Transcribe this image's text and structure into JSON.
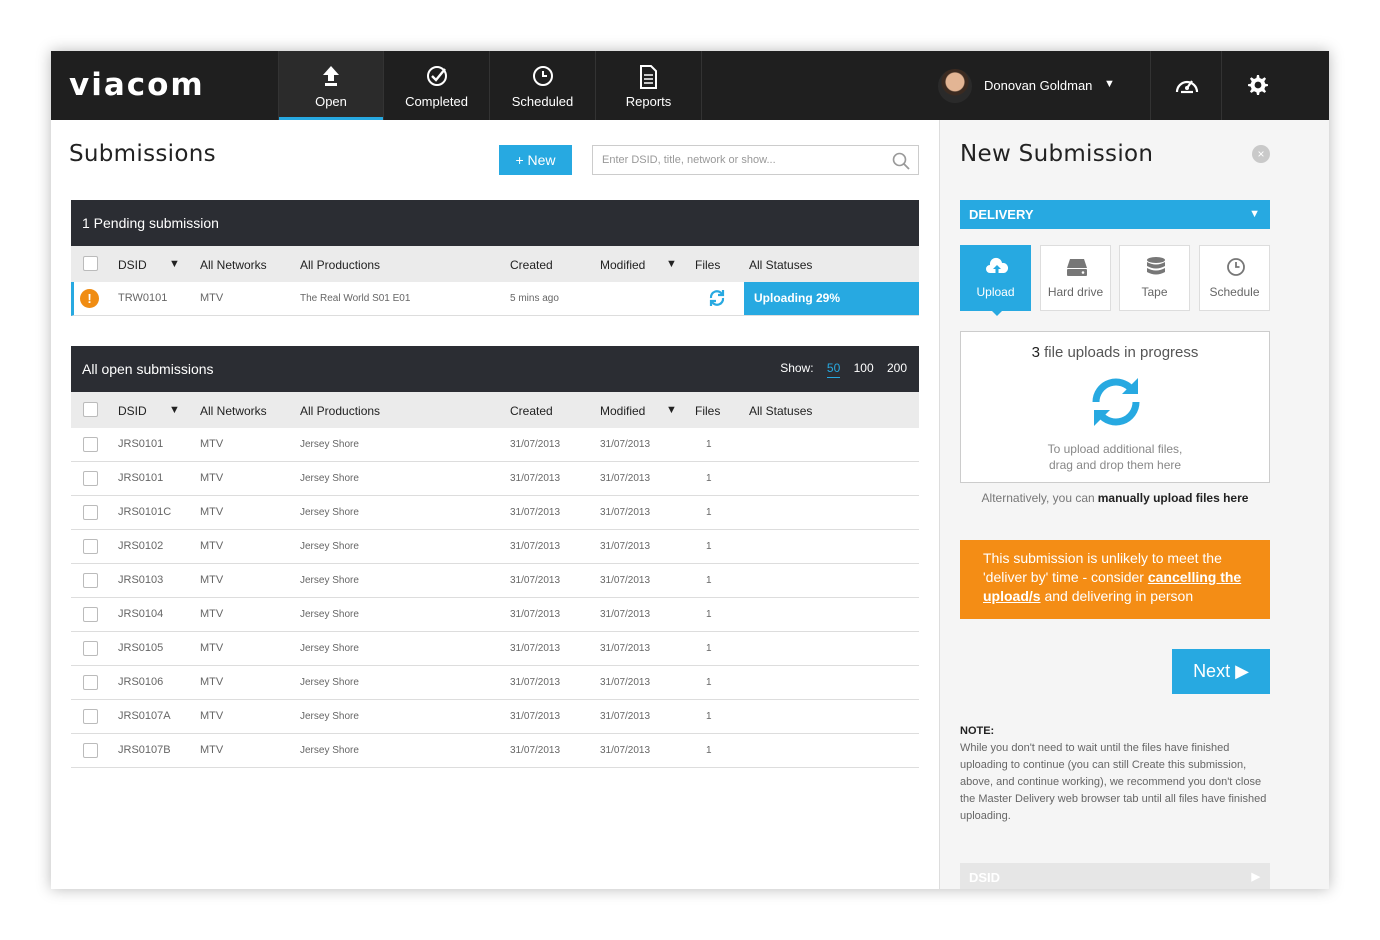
{
  "brand": {
    "logo": "viacom"
  },
  "nav": {
    "items": [
      {
        "label": "Open",
        "icon": "upload-arrow-icon",
        "active": true
      },
      {
        "label": "Completed",
        "icon": "check-circle-icon",
        "active": false
      },
      {
        "label": "Scheduled",
        "icon": "clock-icon",
        "active": false
      },
      {
        "label": "Reports",
        "icon": "document-icon",
        "active": false
      }
    ]
  },
  "user": {
    "name": "Donovan Goldman",
    "caret": "▼"
  },
  "toolbar_icons": [
    "speedometer-icon",
    "gear-icon"
  ],
  "submissions": {
    "title": "Submissions",
    "new_label": "+ New",
    "search_placeholder": "Enter DSID, title, network or show..."
  },
  "pending": {
    "header": "1 Pending submission",
    "columns": {
      "dsid": "DSID",
      "networks": "All Networks",
      "productions": "All Productions",
      "created": "Created",
      "modified": "Modified",
      "files": "Files",
      "statuses": "All Statuses"
    },
    "rows": [
      {
        "dsid": "TRW0101",
        "network": "MTV",
        "production": "The Real World S01 E01",
        "created": "5 mins ago",
        "modified": "",
        "status": "Uploading 29%",
        "warning": "!"
      }
    ]
  },
  "open": {
    "header": "All open submissions",
    "show_label": "Show:",
    "show_options": [
      "50",
      "100",
      "200"
    ],
    "show_selected": "50",
    "columns": {
      "dsid": "DSID",
      "networks": "All Networks",
      "productions": "All Productions",
      "created": "Created",
      "modified": "Modified",
      "files": "Files",
      "statuses": "All Statuses"
    },
    "rows": [
      {
        "dsid": "JRS0101",
        "network": "MTV",
        "production": "Jersey Shore",
        "created": "31/07/2013",
        "modified": "31/07/2013",
        "files": "1"
      },
      {
        "dsid": "JRS0101",
        "network": "MTV",
        "production": "Jersey Shore",
        "created": "31/07/2013",
        "modified": "31/07/2013",
        "files": "1"
      },
      {
        "dsid": "JRS0101C",
        "network": "MTV",
        "production": "Jersey Shore",
        "created": "31/07/2013",
        "modified": "31/07/2013",
        "files": "1"
      },
      {
        "dsid": "JRS0102",
        "network": "MTV",
        "production": "Jersey Shore",
        "created": "31/07/2013",
        "modified": "31/07/2013",
        "files": "1"
      },
      {
        "dsid": "JRS0103",
        "network": "MTV",
        "production": "Jersey Shore",
        "created": "31/07/2013",
        "modified": "31/07/2013",
        "files": "1"
      },
      {
        "dsid": "JRS0104",
        "network": "MTV",
        "production": "Jersey Shore",
        "created": "31/07/2013",
        "modified": "31/07/2013",
        "files": "1"
      },
      {
        "dsid": "JRS0105",
        "network": "MTV",
        "production": "Jersey Shore",
        "created": "31/07/2013",
        "modified": "31/07/2013",
        "files": "1"
      },
      {
        "dsid": "JRS0106",
        "network": "MTV",
        "production": "Jersey Shore",
        "created": "31/07/2013",
        "modified": "31/07/2013",
        "files": "1"
      },
      {
        "dsid": "JRS0107A",
        "network": "MTV",
        "production": "Jersey Shore",
        "created": "31/07/2013",
        "modified": "31/07/2013",
        "files": "1"
      },
      {
        "dsid": "JRS0107B",
        "network": "MTV",
        "production": "Jersey Shore",
        "created": "31/07/2013",
        "modified": "31/07/2013",
        "files": "1"
      }
    ]
  },
  "new_submission": {
    "title": "New Submission",
    "close": "×",
    "type_select": "DELIVERY",
    "caret": "▼",
    "methods": [
      {
        "label": "Upload",
        "icon": "cloud-upload-icon",
        "active": true
      },
      {
        "label": "Hard drive",
        "icon": "hard-drive-icon",
        "active": false
      },
      {
        "label": "Tape",
        "icon": "database-icon",
        "active": false
      },
      {
        "label": "Schedule",
        "icon": "clock-icon",
        "active": false
      }
    ],
    "upload_count": "3",
    "upload_count_suffix": " file uploads in progress",
    "drop_hint_1": "To upload additional files,",
    "drop_hint_2": "drag and drop them here",
    "alt_text": "Alternatively, you can",
    "alt_link": "manually upload files here",
    "warning_1": "This submission is unlikely to meet the 'deliver by' time - consider ",
    "warning_link": "cancelling the upload/s",
    "warning_2": " and delivering in person",
    "next_label": "Next ▶",
    "note_title": "NOTE:",
    "note_body": "While you don't need to wait until the files have finished uploading to continue (you can still Create this submission, above, and continue working), we recommend you don't close the Master Delivery web browser tab until all files have finished uploading.",
    "dsid_label": "DSID",
    "dsid_caret": "▶"
  },
  "colors": {
    "accent": "#27a9e1",
    "warning": "#f48d15",
    "topbar": "#1f1f1f",
    "section_header": "#2b2d33"
  }
}
